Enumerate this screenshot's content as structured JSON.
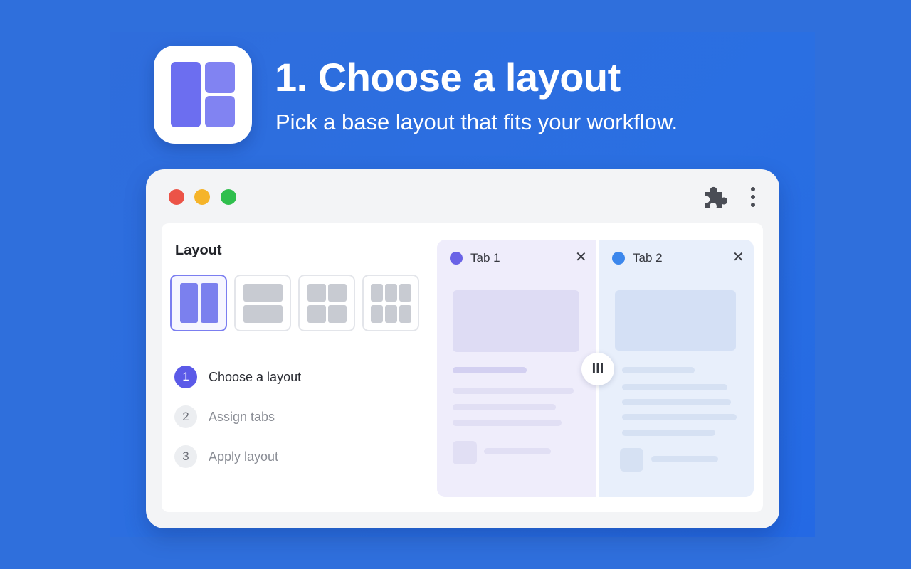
{
  "header": {
    "title": "1. Choose a layout",
    "subtitle": "Pick a base layout that fits your workflow."
  },
  "app_icon": {
    "name": "layout-app-icon"
  },
  "window": {
    "controls": [
      "close",
      "minimize",
      "maximize"
    ],
    "toolbar_icons": [
      "puzzle-icon",
      "kebab-menu-icon"
    ]
  },
  "sidebar": {
    "title": "Layout",
    "layout_options": [
      {
        "name": "two-columns",
        "selected": true
      },
      {
        "name": "two-rows",
        "selected": false
      },
      {
        "name": "grid-2x2",
        "selected": false
      },
      {
        "name": "grid-3x2",
        "selected": false
      }
    ],
    "steps": [
      {
        "number": "1",
        "label": "Choose a layout",
        "active": true
      },
      {
        "number": "2",
        "label": "Assign tabs",
        "active": false
      },
      {
        "number": "3",
        "label": "Apply layout",
        "active": false
      }
    ]
  },
  "preview": {
    "tabs": [
      {
        "label": "Tab 1",
        "dot_color": "#6a63e6",
        "close": "✕"
      },
      {
        "label": "Tab 2",
        "dot_color": "#3c87ec",
        "close": "✕"
      }
    ],
    "resize_handle": "III"
  },
  "colors": {
    "background": "#2f6fdc",
    "accent": "#5b5ae8",
    "selected_layout": "#7b80ee"
  }
}
